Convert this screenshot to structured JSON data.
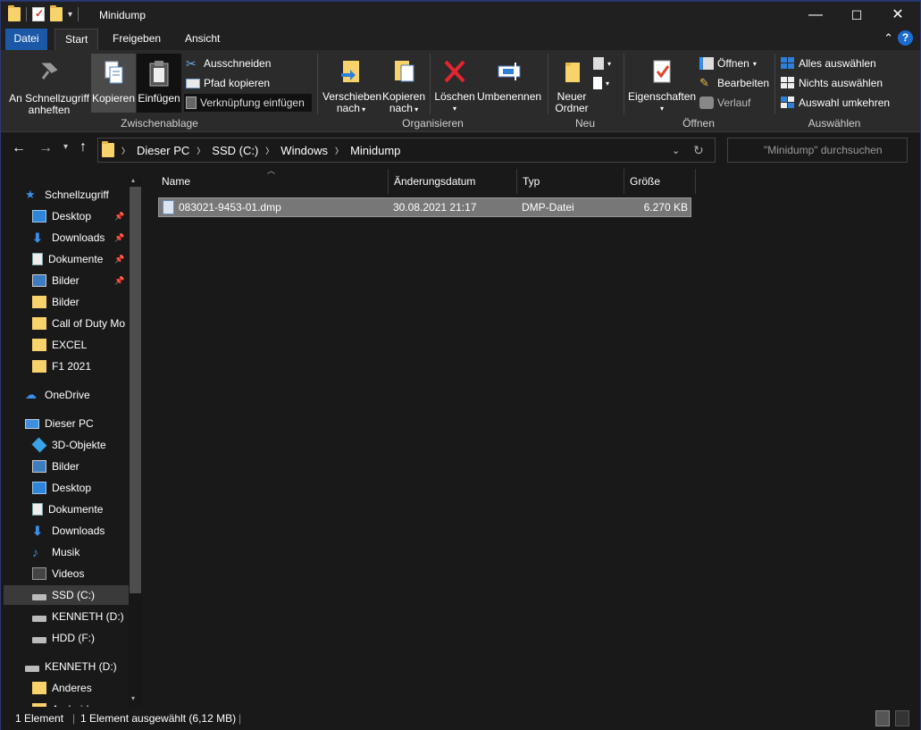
{
  "window": {
    "title": "Minidump"
  },
  "tabs": {
    "file": "Datei",
    "start": "Start",
    "share": "Freigeben",
    "view": "Ansicht"
  },
  "ribbon": {
    "pin": [
      "An Schnellzugriff",
      "anheften"
    ],
    "copy": "Kopieren",
    "paste": "Einfügen",
    "cut": "Ausschneiden",
    "copy_path": "Pfad kopieren",
    "paste_shortcut": "Verknüpfung einfügen",
    "group_clipboard": "Zwischenablage",
    "move_to": [
      "Verschieben",
      "nach"
    ],
    "copy_to": [
      "Kopieren",
      "nach"
    ],
    "delete": "Löschen",
    "rename": "Umbenennen",
    "group_organize": "Organisieren",
    "new_folder": [
      "Neuer",
      "Ordner"
    ],
    "group_new": "Neu",
    "properties": "Eigenschaften",
    "open": "Öffnen",
    "edit": "Bearbeiten",
    "history": "Verlauf",
    "group_open": "Öffnen",
    "select_all": "Alles auswählen",
    "select_none": "Nichts auswählen",
    "invert_selection": "Auswahl umkehren",
    "group_select": "Auswählen"
  },
  "address": {
    "crumbs": [
      "Dieser PC",
      "SSD (C:)",
      "Windows",
      "Minidump"
    ]
  },
  "search": {
    "placeholder": "\"Minidump\" durchsuchen"
  },
  "sidebar": {
    "items": [
      {
        "label": "Schnellzugriff"
      },
      {
        "label": "Desktop"
      },
      {
        "label": "Downloads"
      },
      {
        "label": "Dokumente"
      },
      {
        "label": "Bilder"
      },
      {
        "label": "Bilder"
      },
      {
        "label": "Call of Duty  Mo"
      },
      {
        "label": "EXCEL"
      },
      {
        "label": "F1 2021"
      },
      {
        "label": "OneDrive"
      },
      {
        "label": "Dieser PC"
      },
      {
        "label": "3D-Objekte"
      },
      {
        "label": "Bilder"
      },
      {
        "label": "Desktop"
      },
      {
        "label": "Dokumente"
      },
      {
        "label": "Downloads"
      },
      {
        "label": "Musik"
      },
      {
        "label": "Videos"
      },
      {
        "label": "SSD (C:)"
      },
      {
        "label": "KENNETH (D:)"
      },
      {
        "label": "HDD (F:)"
      },
      {
        "label": "KENNETH (D:)"
      },
      {
        "label": "Anderes"
      },
      {
        "label": "Android"
      }
    ]
  },
  "columns": {
    "name": "Name",
    "date": "Änderungsdatum",
    "type": "Typ",
    "size": "Größe"
  },
  "files": [
    {
      "name": "083021-9453-01.dmp",
      "date": "30.08.2021 21:17",
      "type": "DMP-Datei",
      "size": "6.270 KB"
    }
  ],
  "status": {
    "count": "1 Element",
    "selected": "1 Element ausgewählt (6,12 MB)"
  }
}
